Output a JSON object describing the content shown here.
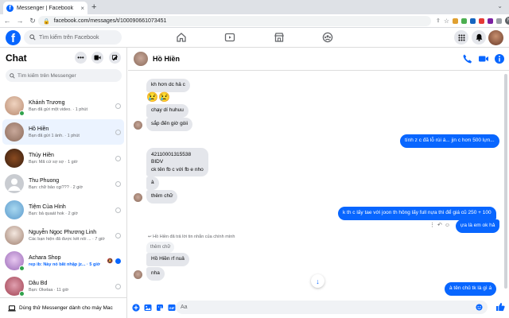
{
  "browser": {
    "tab_title": "Messenger | Facebook",
    "tab_close": "×",
    "new_tab": "+",
    "url": "facebook.com/messages/t/100090661073451",
    "profile_initial": "N"
  },
  "fb": {
    "logo": "f",
    "search_placeholder": "Tìm kiếm trên Facebook",
    "nav_icons": [
      "home-icon",
      "watch-icon",
      "marketplace-icon",
      "groups-icon"
    ],
    "right_icons": [
      "menu-grid-icon",
      "messenger-icon",
      "notifications-icon",
      "profile-avatar"
    ]
  },
  "sidebar": {
    "title": "Chat",
    "options_label": "•••",
    "search_placeholder": "Tìm kiếm trên Messenger",
    "conversations": [
      {
        "name": "Khánh Trương",
        "preview": "Bạn đã gửi một video. · 1 phút",
        "online": true,
        "unread": false
      },
      {
        "name": "Hồ Hiền",
        "preview": "Bạn đã gửi 1 ảnh. · 1 phút",
        "online": false,
        "unread": false,
        "active": true
      },
      {
        "name": "Thủy Hiền",
        "preview": "Bạn: Mã cứ sợ sợ · 1 giờ",
        "online": false,
        "unread": false
      },
      {
        "name": "Thu Phuong",
        "preview": "Bạn: chữ bảo cgi??? · 2 giờ",
        "online": false,
        "unread": false
      },
      {
        "name": "Tiệm Của Hình",
        "preview": "Bạn: bả quaát hok · 2 giờ",
        "online": false,
        "unread": false
      },
      {
        "name": "Nguyễn Ngọc Phương Linh",
        "preview": "Các bạn hiện đã được kết nối ... · 7 giờ",
        "online": false,
        "unread": false
      },
      {
        "name": "Achara Shop",
        "preview": "rep ib: Này nó bắt nhập jz... · 5 giờ",
        "online": true,
        "unread": true
      },
      {
        "name": "Dâu Bd",
        "preview": "Bạn: Okelaa · 11 giờ",
        "online": true,
        "unread": false
      }
    ],
    "mac_promo": "Dùng thử Messenger dành cho máy Mac"
  },
  "chat": {
    "contact_name": "Hồ Hiền",
    "header_icons": [
      "phone-icon",
      "video-call-icon",
      "info-icon"
    ],
    "messages": [
      {
        "text": "kh hơn dc hả c"
      },
      {
        "text": "😢😢"
      },
      {
        "text": "chạy dí huhuu"
      },
      {
        "text": "sắp đến giờ gòii"
      },
      {
        "text": "tính z c đã lỗ rùi á... jịn c hơn 500 lựn..."
      },
      {
        "text": "42110001315538"
      },
      {
        "text": "BIDV"
      },
      {
        "text": "ck tên fb c với fb e nho"
      },
      {
        "text": "à"
      },
      {
        "text": "thêm chữ"
      },
      {
        "text": "k th c lấy tae với joon th hông lấy full nựa thì để giá cũ 250 + 100"
      },
      {
        "text": "ựa là em ok hả"
      },
      {
        "text": "Hồ Hiền đã trả lời tin nhắn của chính mình"
      },
      {
        "text": "thêm chữ"
      },
      {
        "text": "Hồ Hiền rf nuả"
      },
      {
        "text": "nha"
      },
      {
        "text": "à tên chủ tk là gì á"
      }
    ],
    "composer_placeholder": "Aa",
    "composer_icons": [
      "plus-icon",
      "photo-icon",
      "sticker-icon",
      "gif-icon",
      "emoji-icon",
      "like-icon"
    ]
  },
  "colors": {
    "accent": "#0866ff",
    "bubble_in": "#e4e6eb",
    "active_conv": "#ebf3ff"
  }
}
